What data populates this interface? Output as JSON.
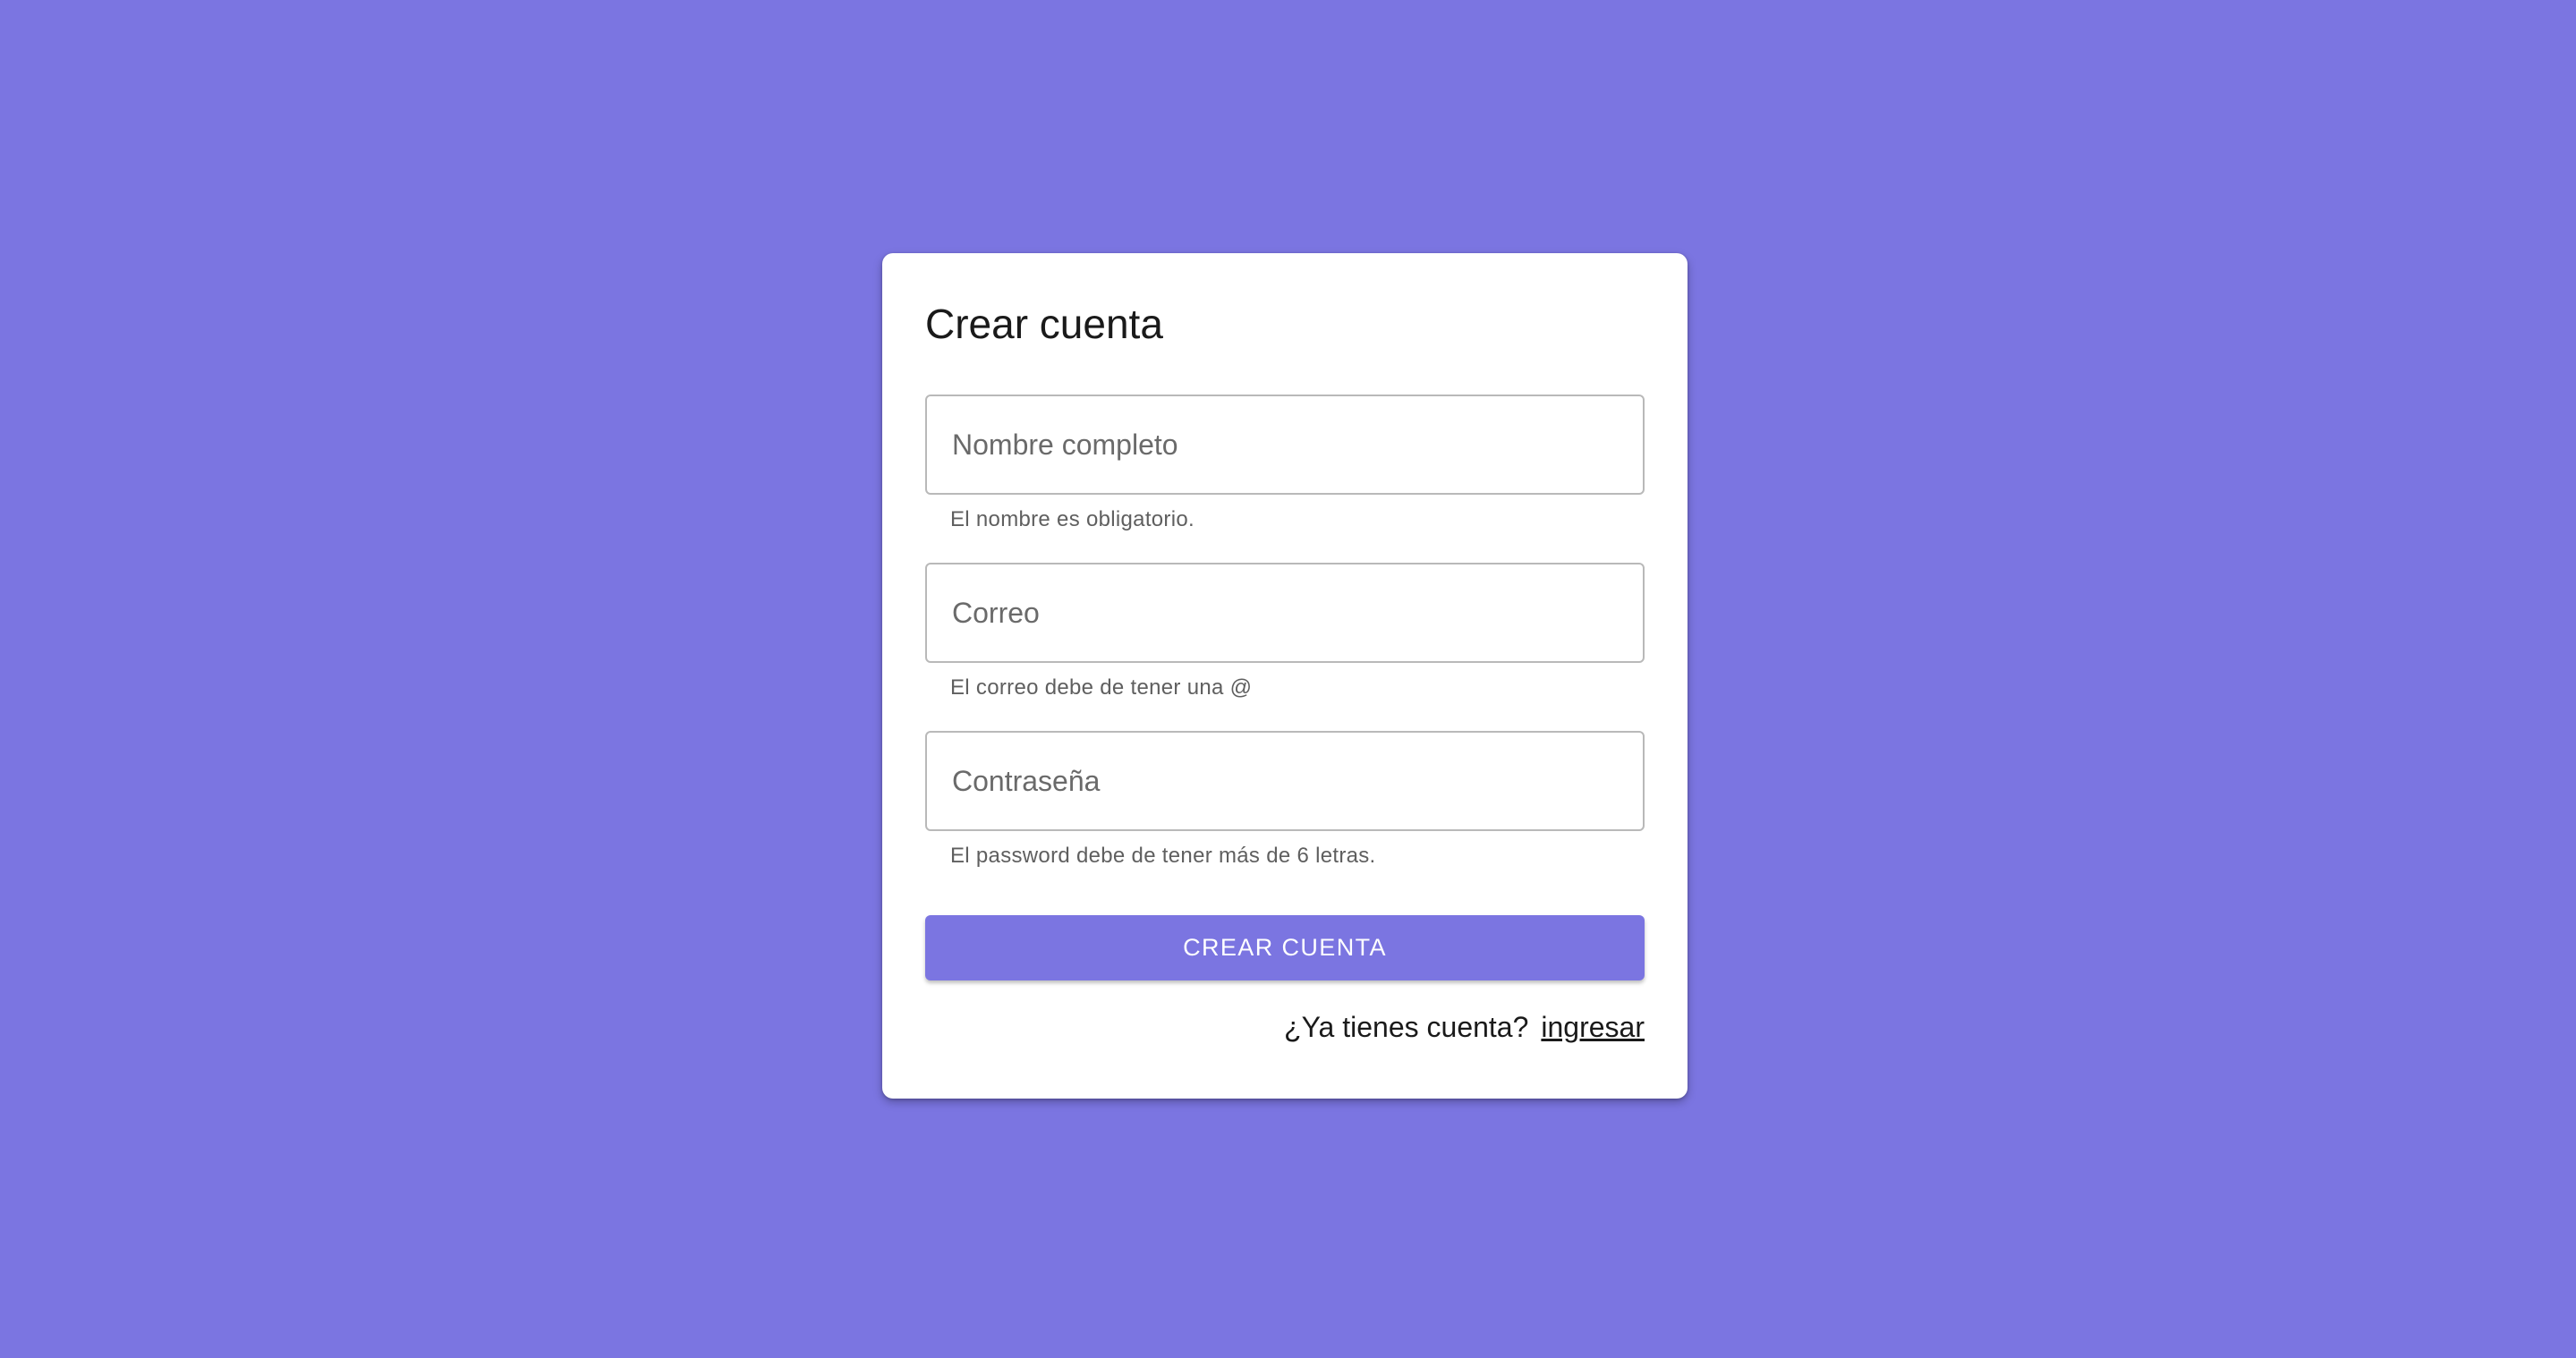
{
  "form": {
    "title": "Crear cuenta",
    "fields": [
      {
        "placeholder": "Nombre completo",
        "helper": "El nombre es obligatorio."
      },
      {
        "placeholder": "Correo",
        "helper": "El correo debe de tener una @"
      },
      {
        "placeholder": "Contraseña",
        "helper": "El password debe de tener más de 6 letras."
      }
    ],
    "submit_label": "Crear cuenta",
    "footer_text": "¿Ya tienes cuenta?",
    "login_link": "ingresar"
  },
  "colors": {
    "background": "#7b75e1",
    "button": "#7b75e1",
    "card": "#ffffff"
  }
}
